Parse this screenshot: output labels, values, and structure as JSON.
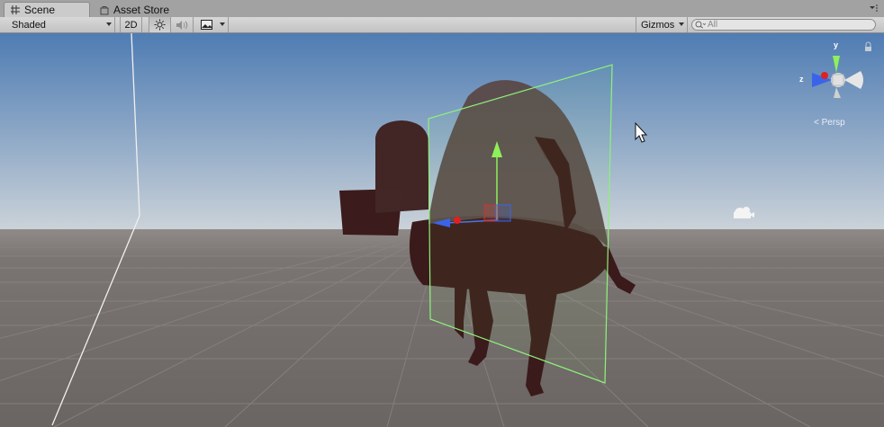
{
  "tabs": [
    {
      "label": "Scene",
      "icon": "scene-grid-icon",
      "active": true
    },
    {
      "label": "Asset Store",
      "icon": "asset-store-icon",
      "active": false
    }
  ],
  "toolbar": {
    "shading_mode": "Shaded",
    "mode_2d": "2D",
    "gizmos": "Gizmos",
    "search_placeholder": "All"
  },
  "viewport": {
    "projection_label": "Persp",
    "axis_labels": {
      "y": "y",
      "z": "z"
    }
  },
  "colors": {
    "sky_top": "#5b84b6",
    "sky_horizon": "#c7cfd7",
    "ground": "#6e6866",
    "model_dark": "#3a1a1a",
    "model_selected": "#5a4948",
    "selection_outline": "#8ef07a"
  }
}
